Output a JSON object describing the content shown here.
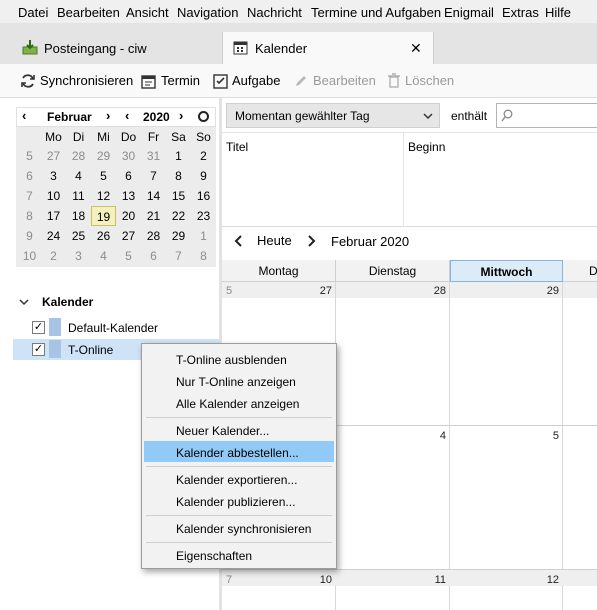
{
  "menu": [
    "Datei",
    "Bearbeiten",
    "Ansicht",
    "Navigation",
    "Nachricht",
    "Termine und Aufgaben",
    "Enigmail",
    "Extras",
    "Hilfe"
  ],
  "tabs": {
    "inbox": "Posteingang - ciw",
    "calendar": "Kalender",
    "close_glyph": "✕"
  },
  "toolbar": {
    "sync": "Synchronisieren",
    "event": "Termin",
    "task": "Aufgabe",
    "edit": "Bearbeiten",
    "delete": "Löschen"
  },
  "minimonth": {
    "month": "Februar",
    "year": "2020",
    "weekdays": [
      "Mo",
      "Di",
      "Mi",
      "Do",
      "Fr",
      "Sa",
      "So"
    ],
    "weeks": [
      {
        "wk": "5",
        "days": [
          "27",
          "28",
          "29",
          "30",
          "31",
          "1",
          "2"
        ]
      },
      {
        "wk": "6",
        "days": [
          "3",
          "4",
          "5",
          "6",
          "7",
          "8",
          "9"
        ]
      },
      {
        "wk": "7",
        "days": [
          "10",
          "11",
          "12",
          "13",
          "14",
          "15",
          "16"
        ]
      },
      {
        "wk": "8",
        "days": [
          "17",
          "18",
          "19",
          "20",
          "21",
          "22",
          "23"
        ]
      },
      {
        "wk": "9",
        "days": [
          "24",
          "25",
          "26",
          "27",
          "28",
          "29",
          "1"
        ]
      },
      {
        "wk": "10",
        "days": [
          "2",
          "3",
          "4",
          "5",
          "6",
          "7",
          "8"
        ]
      }
    ],
    "today": "19"
  },
  "calendars": {
    "header": "Kalender",
    "items": [
      {
        "name": "Default-Kalender",
        "checked": "✓"
      },
      {
        "name": "T-Online",
        "checked": "✓"
      }
    ]
  },
  "filter": {
    "selected": "Momentan gewählter Tag",
    "contains": "enthält"
  },
  "tasklist": {
    "col_title": "Titel",
    "col_start": "Beginn"
  },
  "nav": {
    "today": "Heute",
    "month_label": "Februar 2020"
  },
  "dayheaders": [
    "Montag",
    "Dienstag",
    "Mittwoch",
    "D"
  ],
  "monthgrid": {
    "row1": [
      "5",
      "27",
      "28",
      "29"
    ],
    "row2": [
      "4",
      "5"
    ],
    "row3": [
      "7",
      "10",
      "11",
      "12"
    ]
  },
  "context_menu": {
    "items": [
      "T-Online ausblenden",
      "Nur T-Online anzeigen",
      "Alle Kalender anzeigen",
      "Neuer Kalender...",
      "Kalender abbestellen...",
      "Kalender exportieren...",
      "Kalender publizieren...",
      "Kalender synchronisieren",
      "Eigenschaften"
    ],
    "highlighted": "Kalender abbestellen..."
  }
}
